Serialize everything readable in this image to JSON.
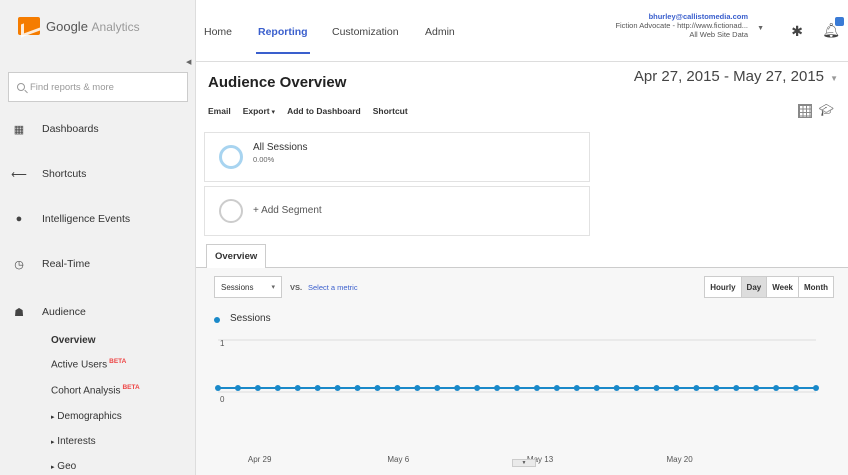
{
  "app": {
    "logo_brand": "Google",
    "logo_product": "Analytics"
  },
  "sidebar": {
    "search_placeholder": "Find reports & more",
    "items": [
      {
        "label": "Dashboards",
        "icon": "dashboard-grid-icon"
      },
      {
        "label": "Shortcuts",
        "icon": "shortcut-arrow-icon"
      },
      {
        "label": "Intelligence Events",
        "icon": "lightbulb-icon"
      },
      {
        "label": "Real-Time",
        "icon": "clock-icon"
      },
      {
        "label": "Audience",
        "icon": "people-icon"
      }
    ],
    "audience_sub": [
      {
        "label": "Overview",
        "active": true
      },
      {
        "label": "Active Users",
        "beta": "BETA"
      },
      {
        "label": "Cohort Analysis",
        "beta": "BETA"
      },
      {
        "label": "Demographics",
        "expand": "▸"
      },
      {
        "label": "Interests",
        "expand": "▸"
      },
      {
        "label": "Geo",
        "expand": "▸"
      }
    ]
  },
  "topbar": {
    "tabs": [
      "Home",
      "Reporting",
      "Customization",
      "Admin"
    ],
    "active_tab": "Reporting",
    "account_email": "bhurley@callistomedia.com",
    "account_property": "Fiction Advocate - http://www.fictionad...",
    "account_view": "All Web Site Data"
  },
  "main": {
    "title": "Audience Overview",
    "date_range": "Apr 27, 2015 - May 27, 2015",
    "toolbar": {
      "email": "Email",
      "export": "Export",
      "add_to_dashboard": "Add to Dashboard",
      "shortcut": "Shortcut"
    },
    "segments": [
      {
        "name": "All Sessions",
        "pct": "0.00%"
      }
    ],
    "add_segment": "+ Add Segment",
    "tab": "Overview",
    "metric": "Sessions",
    "vs_label": "VS.",
    "select_metric": "Select a metric",
    "intervals": [
      "Hourly",
      "Day",
      "Week",
      "Month"
    ],
    "active_interval": "Day"
  },
  "chart_data": {
    "type": "line",
    "series": [
      {
        "name": "Sessions",
        "values": [
          0,
          0,
          0,
          0,
          0,
          0,
          0,
          0,
          0,
          0,
          0,
          0,
          0,
          0,
          0,
          0,
          0,
          0,
          0,
          0,
          0,
          0,
          0,
          0,
          0,
          0,
          0,
          0,
          0,
          0,
          0
        ]
      }
    ],
    "x_tick_labels": [
      "Apr 29",
      "May 6",
      "May 13",
      "May 20"
    ],
    "x_tick_index": [
      2,
      9,
      16,
      23
    ],
    "y_tick_labels": [
      "1",
      "0"
    ],
    "ylim": [
      0,
      1
    ],
    "color": "#1a89c9"
  }
}
